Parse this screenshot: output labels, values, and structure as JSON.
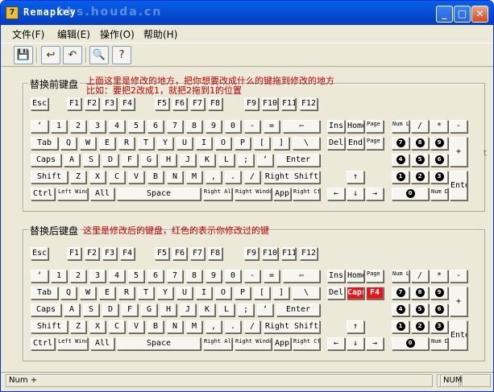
{
  "window": {
    "title": "Remapkey",
    "watermark": "bbs.houda.cn"
  },
  "menu": [
    {
      "label": "文件(F)"
    },
    {
      "label": "编辑(E)"
    },
    {
      "label": "操作(O)"
    },
    {
      "label": "帮助(H)"
    }
  ],
  "toolbar": [
    "save-icon",
    "open-icon",
    "undo-icon",
    "print-preview-icon",
    "help-icon"
  ],
  "upper": {
    "title": "替换前键盘",
    "note1": "上面这里是修改的地方，把你想要改成什么的键拖到修改的地方",
    "note2": "比如：要把2改成1，就把2拖到1的位置"
  },
  "lower": {
    "title": "替换后键盘",
    "note1": "这里是修改后的键盘，红色的表示你修改过的键"
  },
  "keys_before": [
    {
      "id": "esc",
      "label": "Esc"
    },
    {
      "id": "f1",
      "label": "F1"
    },
    {
      "id": "f2",
      "label": "F2"
    },
    {
      "id": "f3",
      "label": "F3"
    },
    {
      "id": "f4",
      "label": "F4"
    },
    {
      "id": "f5",
      "label": "F5"
    },
    {
      "id": "f6",
      "label": "F6"
    },
    {
      "id": "f7",
      "label": "F7"
    },
    {
      "id": "f8",
      "label": "F8"
    },
    {
      "id": "f9",
      "label": "F9"
    },
    {
      "id": "f10",
      "label": "F10"
    },
    {
      "id": "f11",
      "label": "F11"
    },
    {
      "id": "f12",
      "label": "F12"
    },
    {
      "id": "grave",
      "label": "‘"
    },
    {
      "id": "1",
      "label": "1"
    },
    {
      "id": "2",
      "label": "2"
    },
    {
      "id": "3",
      "label": "3"
    },
    {
      "id": "4",
      "label": "4"
    },
    {
      "id": "5",
      "label": "5"
    },
    {
      "id": "6",
      "label": "6"
    },
    {
      "id": "7",
      "label": "7"
    },
    {
      "id": "8",
      "label": "8"
    },
    {
      "id": "9",
      "label": "9"
    },
    {
      "id": "0",
      "label": "0"
    },
    {
      "id": "minus",
      "label": "-"
    },
    {
      "id": "equal",
      "label": "="
    },
    {
      "id": "backspace",
      "label": "⇦"
    },
    {
      "id": "tab",
      "label": "Tab"
    },
    {
      "id": "q",
      "label": "Q"
    },
    {
      "id": "w",
      "label": "W"
    },
    {
      "id": "e",
      "label": "E"
    },
    {
      "id": "r",
      "label": "R"
    },
    {
      "id": "t",
      "label": "T"
    },
    {
      "id": "y",
      "label": "Y"
    },
    {
      "id": "u",
      "label": "U"
    },
    {
      "id": "i",
      "label": "I"
    },
    {
      "id": "o",
      "label": "O"
    },
    {
      "id": "p",
      "label": "P"
    },
    {
      "id": "lbracket",
      "label": "["
    },
    {
      "id": "rbracket",
      "label": "]"
    },
    {
      "id": "backslash",
      "label": "\\"
    },
    {
      "id": "caps",
      "label": "Caps"
    },
    {
      "id": "a",
      "label": "A"
    },
    {
      "id": "s",
      "label": "S"
    },
    {
      "id": "d",
      "label": "D"
    },
    {
      "id": "f",
      "label": "F"
    },
    {
      "id": "g",
      "label": "G"
    },
    {
      "id": "h",
      "label": "H"
    },
    {
      "id": "j",
      "label": "J"
    },
    {
      "id": "k",
      "label": "K"
    },
    {
      "id": "l",
      "label": "L"
    },
    {
      "id": "semicolon",
      "label": ";"
    },
    {
      "id": "quote",
      "label": "‘"
    },
    {
      "id": "enter",
      "label": "Enter"
    },
    {
      "id": "lshift",
      "label": "Shift"
    },
    {
      "id": "z",
      "label": "Z"
    },
    {
      "id": "x",
      "label": "X"
    },
    {
      "id": "c",
      "label": "C"
    },
    {
      "id": "v",
      "label": "V"
    },
    {
      "id": "b",
      "label": "B"
    },
    {
      "id": "n",
      "label": "N"
    },
    {
      "id": "m",
      "label": "M"
    },
    {
      "id": "comma",
      "label": ","
    },
    {
      "id": "period",
      "label": "."
    },
    {
      "id": "slash",
      "label": "/"
    },
    {
      "id": "rshift",
      "label": "Right Shift"
    },
    {
      "id": "lctrl",
      "label": "Ctrl"
    },
    {
      "id": "lwin",
      "label": "Left Windows"
    },
    {
      "id": "lalt",
      "label": "All"
    },
    {
      "id": "space",
      "label": "Space"
    },
    {
      "id": "ralt",
      "label": "Right Alt"
    },
    {
      "id": "rwin",
      "label": "Right Windows"
    },
    {
      "id": "app",
      "label": "App"
    },
    {
      "id": "rctrl",
      "label": "Right Ctrl"
    },
    {
      "id": "ins",
      "label": "Ins"
    },
    {
      "id": "home",
      "label": "Home"
    },
    {
      "id": "pgup",
      "label": "Page Up"
    },
    {
      "id": "del",
      "label": "Del"
    },
    {
      "id": "end",
      "label": "End"
    },
    {
      "id": "pgdn",
      "label": "Page Down"
    },
    {
      "id": "up",
      "label": "↑"
    },
    {
      "id": "left",
      "label": "←"
    },
    {
      "id": "down",
      "label": "↓"
    },
    {
      "id": "right",
      "label": "→"
    },
    {
      "id": "numlock",
      "label": "Num Lock"
    },
    {
      "id": "ndiv",
      "label": "/"
    },
    {
      "id": "nmul",
      "label": "*"
    },
    {
      "id": "nsub",
      "label": "-"
    },
    {
      "id": "n7",
      "label": "7"
    },
    {
      "id": "n8",
      "label": "8"
    },
    {
      "id": "n9",
      "label": "9"
    },
    {
      "id": "nadd",
      "label": "+"
    },
    {
      "id": "n4",
      "label": "4"
    },
    {
      "id": "n5",
      "label": "5"
    },
    {
      "id": "n6",
      "label": "6"
    },
    {
      "id": "n1",
      "label": "1"
    },
    {
      "id": "n2",
      "label": "2"
    },
    {
      "id": "n3",
      "label": "3"
    },
    {
      "id": "nenter",
      "label": "Enter"
    },
    {
      "id": "n0",
      "label": "0"
    },
    {
      "id": "ndel",
      "label": "Num Del"
    }
  ],
  "keys_after_changed": [
    {
      "id": "caps",
      "label": "Caps",
      "color": "#E8141B"
    },
    {
      "id": "f4",
      "label": "F4",
      "color": "#E8141B"
    }
  ],
  "keys_after_renamed": {
    "del": "Del",
    "lalt": "All",
    "lshift": "Shift"
  },
  "statusbar": {
    "left": "Num +",
    "right": "NUM"
  },
  "edge_text": "t"
}
